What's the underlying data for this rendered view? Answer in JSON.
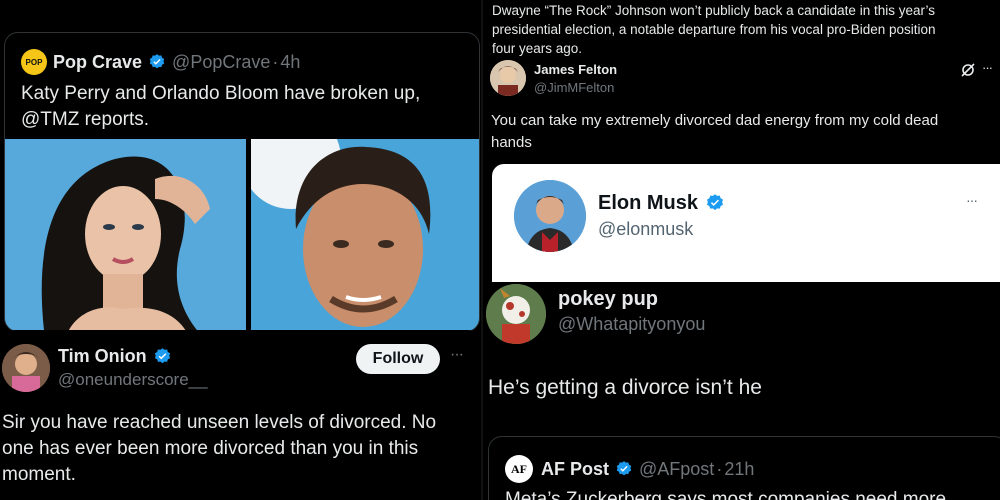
{
  "left": {
    "embed": {
      "logo_text": "POP",
      "name": "Pop Crave",
      "handle": "@PopCrave",
      "sep": "·",
      "age": "4h",
      "text_line1": "Katy Perry and Orlando Bloom have broken up,",
      "text_line2": "@TMZ reports."
    },
    "reply": {
      "name": "Tim Onion",
      "handle": "@oneunderscore__",
      "follow_label": "Follow",
      "more": "···",
      "text_line1": "Sir you have reached unseen levels of divorced. No",
      "text_line2": "one has ever been more divorced than you in this",
      "text_line3": "moment."
    }
  },
  "right": {
    "top_text_line1": "Dwayne “The Rock” Johnson won’t publicly back a candidate in this year’s",
    "top_text_line2": "presidential election, a notable departure from his vocal pro-Biden position",
    "top_text_line3": "four years ago.",
    "james": {
      "name": "James Felton",
      "handle": "@JimMFelton",
      "more": "···",
      "text_line1": "You can take my extremely divorced dad energy from my cold dead",
      "text_line2": "hands"
    },
    "elon": {
      "name": "Elon Musk",
      "handle": "@elonmusk",
      "more": "···"
    },
    "pokey": {
      "name": "pokey pup",
      "handle": "@Whatapityonyou",
      "text": "He’s getting a divorce isn’t he"
    },
    "afpost": {
      "logo_text": "AF",
      "name": "AF Post",
      "handle": "@AFpost",
      "sep": "·",
      "age": "21h",
      "text_partial": "Meta’s Zuckerberg says most companies need more"
    }
  },
  "colors": {
    "verified": "#1d9bf0",
    "muted": "#71767b",
    "text": "#e7e9ea",
    "photo_bg": "#4aa3d8"
  }
}
